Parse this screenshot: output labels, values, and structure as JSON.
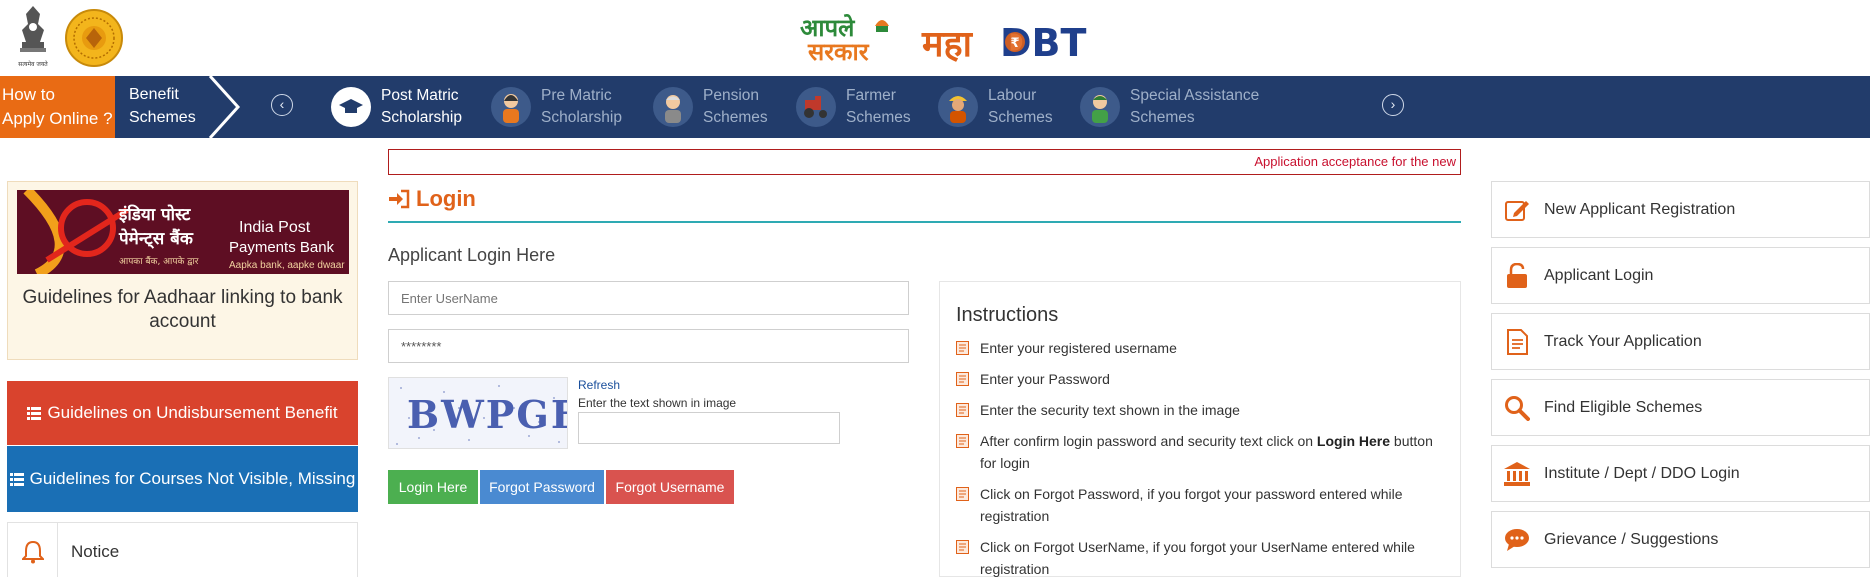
{
  "header": {
    "brand_aaple": "आपले",
    "brand_sarkar": "सरकार",
    "brand_maha": "महा",
    "brand_dbt": "DBT",
    "emblem_motto": "सत्यमेव जयते"
  },
  "nav": {
    "howto_line1": "How to",
    "howto_line2": "Apply Online ?",
    "benefit_line1": "Benefit",
    "benefit_line2": "Schemes",
    "prev_symbol": "‹",
    "next_symbol": "›",
    "items": [
      {
        "line1": "Post Matric",
        "line2": "Scholarship",
        "active": true
      },
      {
        "line1": "Pre Matric",
        "line2": "Scholarship",
        "active": false
      },
      {
        "line1": "Pension",
        "line2": "Schemes",
        "active": false
      },
      {
        "line1": "Farmer",
        "line2": "Schemes",
        "active": false
      },
      {
        "line1": "Labour",
        "line2": "Schemes",
        "active": false
      },
      {
        "line1": "Special Assistance",
        "line2": "Schemes",
        "active": false
      }
    ]
  },
  "marquee": {
    "text": "Application acceptance for the new"
  },
  "left": {
    "ippb_hindi_1": "इंडिया पोस्ट",
    "ippb_hindi_2": "पेमेन्ट्स बैंक",
    "ippb_hindi_tag": "आपका बैंक, आपके द्वार",
    "ippb_en_1": "India Post",
    "ippb_en_2": "Payments Bank",
    "ippb_en_tag": "Aapka bank, aapke dwaar",
    "ippb_caption": "Guidelines for Aadhaar linking to bank account",
    "btn_undisbursement": "Guidelines on Undisbursement Benefit",
    "btn_courses": "Guidelines for Courses Not Visible, Missing",
    "notice_label": "Notice"
  },
  "login": {
    "title": "Login",
    "subtitle": "Applicant Login Here",
    "username_placeholder": "Enter UserName",
    "password_value": "********",
    "captcha_text": "BWPGF",
    "refresh_label": "Refresh",
    "captcha_label": "Enter the text shown in image",
    "btn_login": "Login Here",
    "btn_forgot_password": "Forgot Password",
    "btn_forgot_username": "Forgot Username"
  },
  "instructions": {
    "title": "Instructions",
    "items": [
      {
        "pre": "Enter your registered username",
        "bold": "",
        "post": ""
      },
      {
        "pre": "Enter your Password",
        "bold": "",
        "post": ""
      },
      {
        "pre": "Enter the security text shown in the image",
        "bold": "",
        "post": ""
      },
      {
        "pre": "After confirm login password and security text click on ",
        "bold": "Login Here",
        "post": " button for login"
      },
      {
        "pre": "Click on Forgot Password, if you forgot your password entered while registration",
        "bold": "",
        "post": ""
      },
      {
        "pre": "Click on Forgot UserName, if you forgot your UserName entered while registration",
        "bold": "",
        "post": ""
      }
    ]
  },
  "side": {
    "items": [
      {
        "label": "New Applicant Registration",
        "icon": "edit-icon"
      },
      {
        "label": "Applicant Login",
        "icon": "unlock-icon"
      },
      {
        "label": "Track Your Application",
        "icon": "document-icon"
      },
      {
        "label": "Find Eligible Schemes",
        "icon": "search-icon"
      },
      {
        "label": "Institute / Dept / DDO Login",
        "icon": "institution-icon"
      },
      {
        "label": "Grievance / Suggestions",
        "icon": "chat-icon"
      }
    ]
  },
  "colors": {
    "navbar": "#223c6b",
    "howto": "#e96b14",
    "accent_orange": "#e0621a",
    "btn_login": "#4caf50",
    "btn_forgot_password": "#4a8ad1",
    "btn_forgot_username": "#d9534f",
    "btn_undisbursement": "#d9432d",
    "btn_courses": "#1a6fb5"
  }
}
